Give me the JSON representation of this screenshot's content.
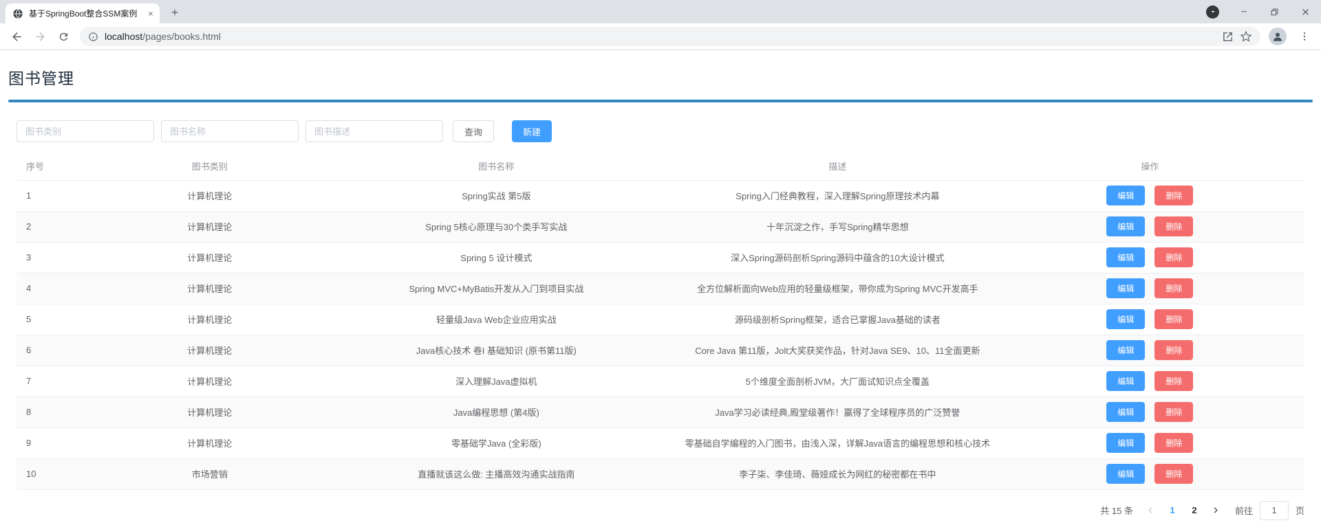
{
  "browser": {
    "tab_title": "基于SpringBoot整合SSM案例",
    "url_host": "localhost",
    "url_path": "/pages/books.html",
    "icons": {
      "favicon": "globe-icon",
      "tab_close": "close-icon",
      "new_tab": "plus-icon",
      "tab_search": "caret-down-icon",
      "minimize": "minus-icon",
      "restore": "overlapping-squares-icon",
      "window_close": "x-icon",
      "back": "arrow-left-icon",
      "forward": "arrow-right-icon",
      "reload": "circular-arrow-icon",
      "site_info": "info-circle-icon",
      "share": "box-arrow-icon",
      "bookmark": "star-outline-icon",
      "profile": "person-icon",
      "menu": "three-dots-vertical-icon"
    }
  },
  "page": {
    "title": "图书管理"
  },
  "colors": {
    "primary": "#409EFF",
    "danger": "#F56C6C",
    "divider": "#3287C1"
  },
  "search": {
    "category_placeholder": "图书类别",
    "name_placeholder": "图书名称",
    "description_placeholder": "图书描述",
    "query_label": "查询",
    "create_label": "新建"
  },
  "table": {
    "headers": [
      "序号",
      "图书类别",
      "图书名称",
      "描述",
      "操作"
    ],
    "edit_label": "编辑",
    "delete_label": "删除",
    "rows": [
      {
        "id": "1",
        "category": "计算机理论",
        "name": "Spring实战 第5版",
        "description": "Spring入门经典教程，深入理解Spring原理技术内幕"
      },
      {
        "id": "2",
        "category": "计算机理论",
        "name": "Spring 5核心原理与30个类手写实战",
        "description": "十年沉淀之作，手写Spring精华思想"
      },
      {
        "id": "3",
        "category": "计算机理论",
        "name": "Spring 5 设计模式",
        "description": "深入Spring源码剖析Spring源码中蕴含的10大设计模式"
      },
      {
        "id": "4",
        "category": "计算机理论",
        "name": "Spring MVC+MyBatis开发从入门到项目实战",
        "description": "全方位解析面向Web应用的轻量级框架，带你成为Spring MVC开发高手"
      },
      {
        "id": "5",
        "category": "计算机理论",
        "name": "轻量级Java Web企业应用实战",
        "description": "源码级剖析Spring框架，适合已掌握Java基础的读者"
      },
      {
        "id": "6",
        "category": "计算机理论",
        "name": "Java核心技术 卷I 基础知识 (原书第11版)",
        "description": "Core Java 第11版，Jolt大奖获奖作品，针对Java SE9、10、11全面更新"
      },
      {
        "id": "7",
        "category": "计算机理论",
        "name": "深入理解Java虚拟机",
        "description": "5个维度全面剖析JVM，大厂面试知识点全覆盖"
      },
      {
        "id": "8",
        "category": "计算机理论",
        "name": "Java编程思想 (第4版)",
        "description": "Java学习必读经典,殿堂级著作！赢得了全球程序员的广泛赞誉"
      },
      {
        "id": "9",
        "category": "计算机理论",
        "name": "零基础学Java (全彩版)",
        "description": "零基础自学编程的入门图书，由浅入深，详解Java语言的编程思想和核心技术"
      },
      {
        "id": "10",
        "category": "市场营销",
        "name": "直播就该这么做: 主播高效沟通实战指南",
        "description": "李子柒、李佳琦、薇娅成长为网红的秘密都在书中"
      }
    ]
  },
  "pagination": {
    "total_label": "共 15 条",
    "pages": [
      "1",
      "2"
    ],
    "active_page": "1",
    "goto_label": "前往",
    "goto_value": "1",
    "page_unit": "页"
  }
}
